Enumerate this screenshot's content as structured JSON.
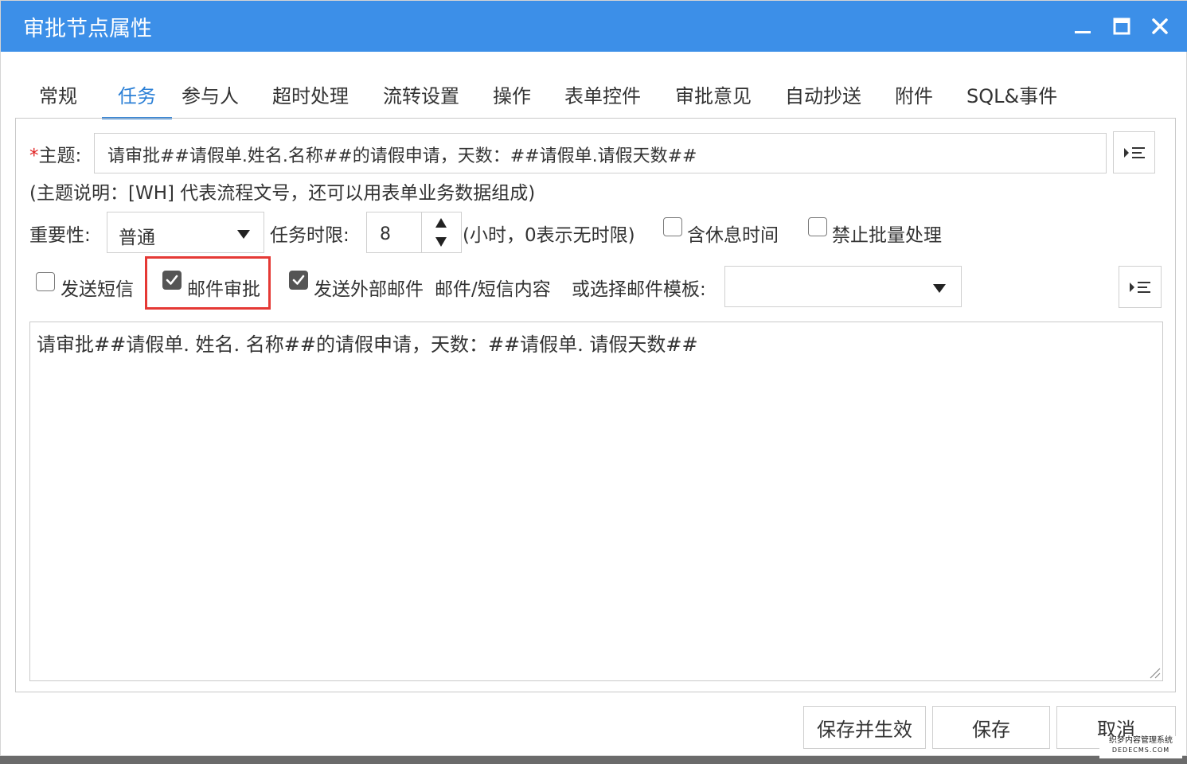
{
  "dialog": {
    "title": "审批节点属性",
    "colors": {
      "titlebar": "#3c8fe8",
      "accent": "#2a7fd6",
      "highlight": "#e53935"
    }
  },
  "window_controls": {
    "minimize_icon": "minimize-icon",
    "maximize_icon": "maximize-icon",
    "close_icon": "close-icon"
  },
  "tabs": [
    {
      "label": "常规"
    },
    {
      "label": "任务",
      "active": true
    },
    {
      "label": "参与人"
    },
    {
      "label": "超时处理"
    },
    {
      "label": "流转设置"
    },
    {
      "label": "操作"
    },
    {
      "label": "表单控件"
    },
    {
      "label": "审批意见"
    },
    {
      "label": "自动抄送"
    },
    {
      "label": "附件"
    },
    {
      "label": "SQL&事件"
    }
  ],
  "form": {
    "subject_required_mark": "*",
    "subject_label": "主题:",
    "subject_value": "请审批##请假单.姓名.名称##的请假申请，天数：##请假单.请假天数##",
    "subject_hint": "(主题说明：[WH] 代表流程文号，还可以用表单业务数据组成)",
    "importance_label": "重要性:",
    "importance_value": "普通",
    "time_limit_label": "任务时限:",
    "time_limit_value": "8",
    "time_limit_hint": "(小时，0表示无时限)",
    "include_rest_label": "含休息时间",
    "include_rest_checked": false,
    "no_batch_label": "禁止批量处理",
    "no_batch_checked": false,
    "send_sms_label": "发送短信",
    "send_sms_checked": false,
    "email_approval_label": "邮件审批",
    "email_approval_checked": true,
    "send_external_email_label": "发送外部邮件",
    "send_external_email_checked": true,
    "email_sms_content_label": "邮件/短信内容",
    "template_label": "或选择邮件模板:",
    "template_value": "",
    "content_value": "请审批##请假单. 姓名. 名称##的请假申请，天数：##请假单. 请假天数##"
  },
  "buttons": {
    "save_activate": "保存并生效",
    "save": "保存",
    "cancel": "取消"
  },
  "watermark": {
    "line1": "织梦内容管理系统",
    "line2": "DEDECMS.COM"
  }
}
